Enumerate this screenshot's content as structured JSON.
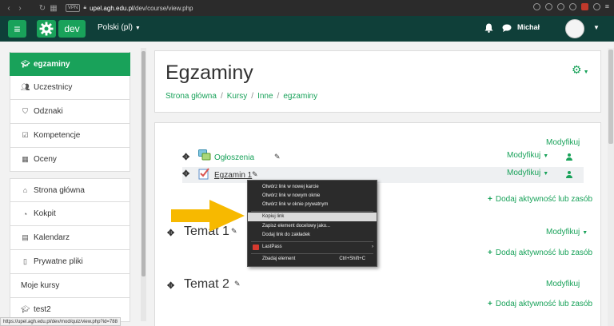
{
  "browser": {
    "url_host": "upel.agh.edu.pl",
    "url_path": "/dev/course/view.php",
    "vpn_label": "VPN"
  },
  "header": {
    "menu_icon": "hamburger-icon",
    "logo_icon": "moodle-gear-icon",
    "site_label": "dev",
    "language": "Polski (pl)",
    "user_name": "Michał",
    "accent": "#19a25a",
    "bg": "#0f3f39"
  },
  "sidebar": {
    "items": [
      {
        "label": "egzaminy",
        "icon": "graduation-cap-icon",
        "active": true
      },
      {
        "label": "Uczestnicy",
        "icon": "users-icon"
      },
      {
        "label": "Odznaki",
        "icon": "shield-icon"
      },
      {
        "label": "Kompetencje",
        "icon": "check-square-icon"
      },
      {
        "label": "Oceny",
        "icon": "table-icon"
      }
    ],
    "items2": [
      {
        "label": "Strona główna",
        "icon": "home-icon"
      },
      {
        "label": "Kokpit",
        "icon": "dashboard-icon"
      },
      {
        "label": "Kalendarz",
        "icon": "calendar-icon"
      },
      {
        "label": "Prywatne pliki",
        "icon": "file-icon"
      },
      {
        "label": "Moje kursy",
        "icon": ""
      },
      {
        "label": "test2",
        "icon": "graduation-cap-icon"
      }
    ]
  },
  "page": {
    "title": "Egzaminy",
    "breadcrumb": [
      "Strona główna",
      "Kursy",
      "Inne",
      "egzaminy"
    ]
  },
  "content": {
    "edit_label": "Modyfikuj",
    "add_activity": "Dodaj aktywność lub zasób",
    "activities": [
      {
        "name": "Ogłoszenia",
        "icon": "forum-icon"
      },
      {
        "name": "Egzamin 1",
        "icon": "quiz-icon"
      }
    ],
    "sections": [
      "Temat 1",
      "Temat 2"
    ]
  },
  "context_menu": {
    "items": [
      "Otwórz link w nowej karcie",
      "Otwórz link w nowym oknie",
      "Otwórz link w oknie prywatnym",
      "Kopiuj link",
      "Zapisz element docelowy jako...",
      "Dodaj link do zakładek",
      "LastPass",
      "Zbadaj element"
    ],
    "inspect_shortcut": "Ctrl+Shift+C",
    "highlighted": "Kopiuj link"
  },
  "status_url": "https://upel.agh.edu.pl/dev/mod/quiz/view.php?id=788"
}
